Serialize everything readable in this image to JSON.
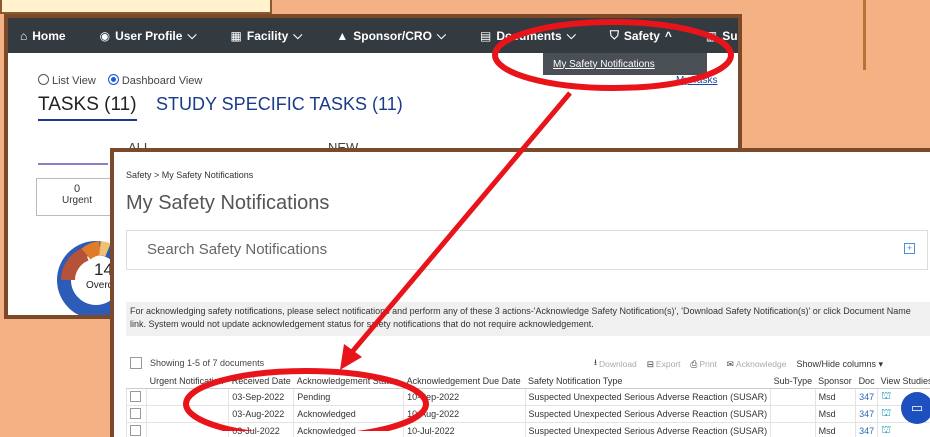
{
  "navbar": {
    "items": [
      {
        "label": "Home",
        "icon": "home-icon"
      },
      {
        "label": "User Profile",
        "icon": "user-circle-icon",
        "chevron": "⌵"
      },
      {
        "label": "Facility",
        "icon": "building-icon",
        "chevron": "⌵"
      },
      {
        "label": "Sponsor/CRO",
        "icon": "graduation-cap-icon",
        "chevron": "⌵"
      },
      {
        "label": "Documents",
        "icon": "document-icon",
        "chevron": "⌵"
      },
      {
        "label": "Safety",
        "icon": "shield-icon",
        "chevron": "^"
      },
      {
        "label": "Survey",
        "icon": "bar-chart-icon",
        "chevron": "⌵"
      }
    ],
    "dropdown_item": "My Safety Notifications"
  },
  "back_view": {
    "list_view": "List View",
    "dashboard_view": "Dashboard View",
    "my_tasks": "My Tasks",
    "tab_tasks": "TASKS (11)",
    "tab_study": "STUDY SPECIFIC TASKS (11)",
    "filter_all": "ALL",
    "filter_new": "NEW",
    "urgent_count": "0",
    "urgent_label": "Urgent",
    "overdue_count": "14",
    "overdue_label": "Overdue"
  },
  "front_view": {
    "breadcrumb": "Safety > My Safety Notifications",
    "title": "My Safety Notifications",
    "search_placeholder": "Search Safety Notifications",
    "info_text": "For acknowledging safety notifications, please select notifications and perform any of these 3 actions-'Acknowledge Safety Notification(s)', 'Download Safety Notification(s)' or click Document Name link. System would not update acknowledgement status for safety notifications that do not require acknowledgement.",
    "showing": "Showing  1-5 of 7  documents",
    "actions": {
      "download": "Download",
      "export": "Export",
      "print": "Print",
      "acknowledge": "Acknowledge",
      "show_hide": "Show/Hide columns ▾"
    },
    "columns": [
      "",
      "Urgent Notification",
      "Received Date",
      "Acknowledgement Status",
      "Acknowledgement Due Date",
      "Safety Notification Type",
      "Sub-Type",
      "Sponsor",
      "Doc",
      "View Studies"
    ],
    "rows": [
      {
        "urgent": "",
        "received": "03-Sep-2022",
        "status": "Pending",
        "due": "10-Sep-2022",
        "type": "Suspected Unexpected Serious Adverse Reaction (SUSAR)",
        "subtype": "",
        "sponsor": "Msd",
        "doc": "347"
      },
      {
        "urgent": "",
        "received": "03-Aug-2022",
        "status": "Acknowledged",
        "due": "10-Aug-2022",
        "type": "Suspected Unexpected Serious Adverse Reaction (SUSAR)",
        "subtype": "",
        "sponsor": "Msd",
        "doc": "347"
      },
      {
        "urgent": "",
        "received": "03-Jul-2022",
        "status": "Acknowledged",
        "due": "10-Jul-2022",
        "type": "Suspected Unexpected Serious Adverse Reaction (SUSAR)",
        "subtype": "",
        "sponsor": "Msd",
        "doc": "347"
      }
    ]
  },
  "colors": {
    "background": "#f4b183",
    "navbar": "#333a40",
    "annotation_red": "#e8141a",
    "frame_brown": "#7a4a2a"
  }
}
